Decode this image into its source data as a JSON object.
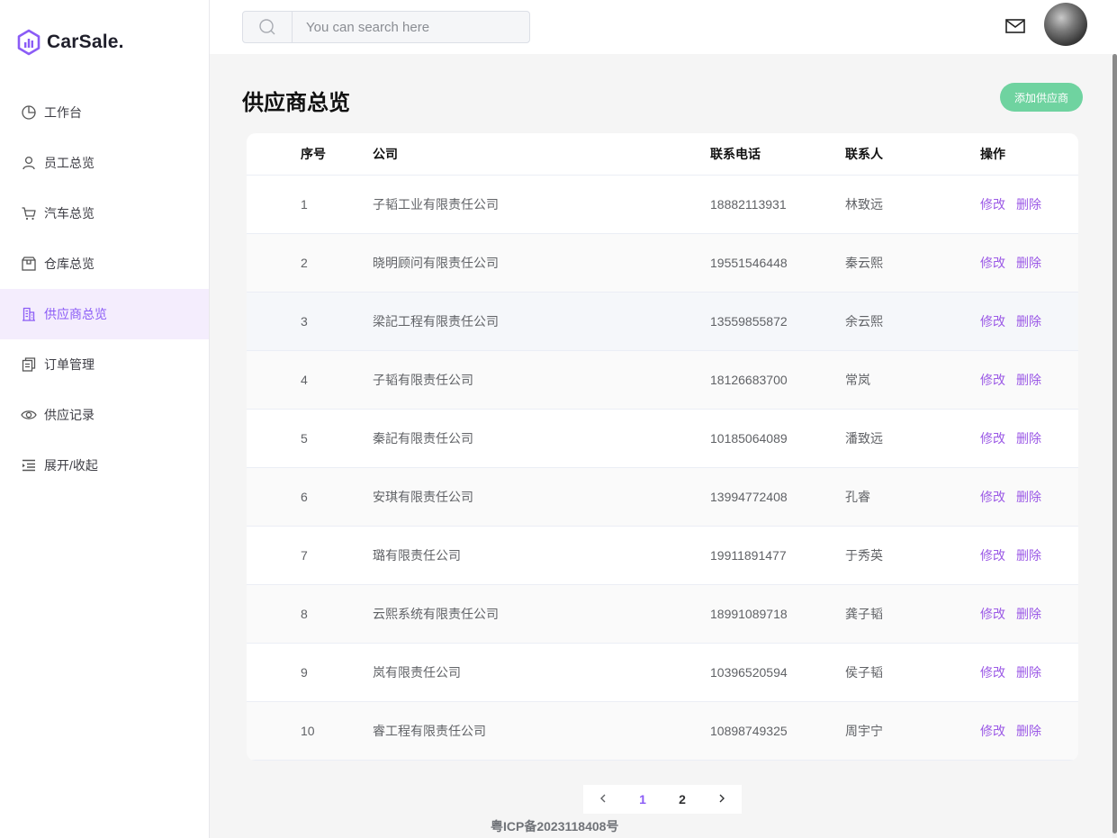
{
  "app": {
    "logo_text": "CarSale."
  },
  "sidebar": {
    "items": [
      {
        "label": "工作台",
        "icon": "pie-chart-icon"
      },
      {
        "label": "员工总览",
        "icon": "user-icon"
      },
      {
        "label": "汽车总览",
        "icon": "cart-icon"
      },
      {
        "label": "仓库总览",
        "icon": "box-icon"
      },
      {
        "label": "供应商总览",
        "icon": "office-building-icon",
        "active": true
      },
      {
        "label": "订单管理",
        "icon": "document-copy-icon"
      },
      {
        "label": "供应记录",
        "icon": "eye-icon"
      },
      {
        "label": "展开/收起",
        "icon": "fold-icon"
      }
    ]
  },
  "header": {
    "search_placeholder": "You can search here"
  },
  "main": {
    "title": "供应商总览",
    "add_button": "添加供应商",
    "table": {
      "columns": [
        "序号",
        "公司",
        "联系电话",
        "联系人",
        "操作"
      ],
      "edit_label": "修改",
      "delete_label": "删除",
      "rows": [
        {
          "index": "1",
          "company": "子韬工业有限责任公司",
          "phone": "18882113931",
          "contact": "林致远"
        },
        {
          "index": "2",
          "company": "晓明顾问有限责任公司",
          "phone": "19551546448",
          "contact": "秦云熙"
        },
        {
          "index": "3",
          "company": "梁記工程有限责任公司",
          "phone": "13559855872",
          "contact": "余云熙"
        },
        {
          "index": "4",
          "company": "子韬有限责任公司",
          "phone": "18126683700",
          "contact": "常岚"
        },
        {
          "index": "5",
          "company": "秦記有限责任公司",
          "phone": "10185064089",
          "contact": "潘致远"
        },
        {
          "index": "6",
          "company": "安琪有限责任公司",
          "phone": "13994772408",
          "contact": "孔睿"
        },
        {
          "index": "7",
          "company": "璐有限责任公司",
          "phone": "19911891477",
          "contact": "于秀英"
        },
        {
          "index": "8",
          "company": "云熙系统有限责任公司",
          "phone": "18991089718",
          "contact": "龚子韬"
        },
        {
          "index": "9",
          "company": "岚有限责任公司",
          "phone": "10396520594",
          "contact": "侯子韬"
        },
        {
          "index": "10",
          "company": "睿工程有限责任公司",
          "phone": "10898749325",
          "contact": "周宇宁"
        }
      ]
    },
    "pagination": {
      "prev_icon": "chevron-left-icon",
      "pages": [
        "1",
        "2"
      ],
      "current": "1",
      "next_icon": "chevron-right-icon"
    },
    "footer": "粤ICP备2023118408号"
  },
  "colors": {
    "accent": "#8b5cf6",
    "add_button": "#6fd3a0",
    "link": "#9b59e6"
  }
}
